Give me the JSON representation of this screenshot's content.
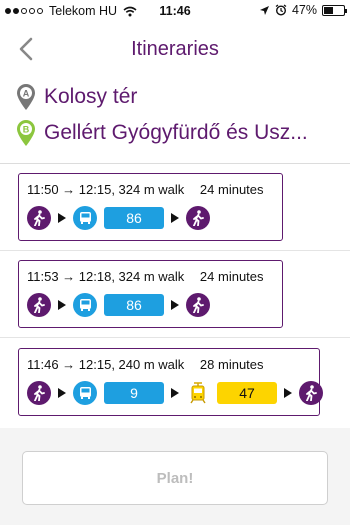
{
  "status": {
    "carrier": "Telekom HU",
    "time": "11:46",
    "battery": "47%",
    "battery_level": 0.47
  },
  "nav": {
    "title": "Itineraries",
    "back_icon": "chevron-left-icon"
  },
  "origin": {
    "marker": "A",
    "name": "Kolosy tér"
  },
  "destination": {
    "marker": "B",
    "name": "Gellért Gyógyfürdő és Usz..."
  },
  "itineraries": [
    {
      "summary": "11:50 → 12:15, 324 m walk",
      "duration": "24 minutes",
      "route1": "86"
    },
    {
      "summary": "11:53 → 12:18, 324 m walk",
      "duration": "24 minutes",
      "route1": "86"
    },
    {
      "summary": "11:46 → 12:15, 240 m walk",
      "duration": "28 minutes",
      "route1": "9",
      "route2": "47"
    }
  ],
  "plan_button": "Plan!",
  "colors": {
    "primary": "#5e1a6e",
    "bus": "#1e9fe0",
    "tram": "#fdd400",
    "marker_a": "#777777",
    "marker_b": "#8cc63e"
  }
}
